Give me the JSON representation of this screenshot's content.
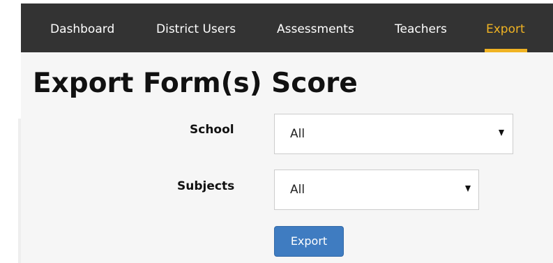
{
  "nav": {
    "items": [
      {
        "label": "Dashboard"
      },
      {
        "label": "District Users"
      },
      {
        "label": "Assessments"
      },
      {
        "label": "Teachers"
      },
      {
        "label": "Export",
        "active": true
      }
    ]
  },
  "page": {
    "title": "Export Form(s) Score"
  },
  "form": {
    "school": {
      "label": "School",
      "value": "All"
    },
    "subjects": {
      "label": "Subjects",
      "value": "All"
    },
    "export_label": "Export"
  },
  "colors": {
    "navbar_bg": "#333333",
    "active_accent": "#f0b323",
    "button_bg": "#3f7cc1",
    "content_bg": "#f6f6f6"
  }
}
